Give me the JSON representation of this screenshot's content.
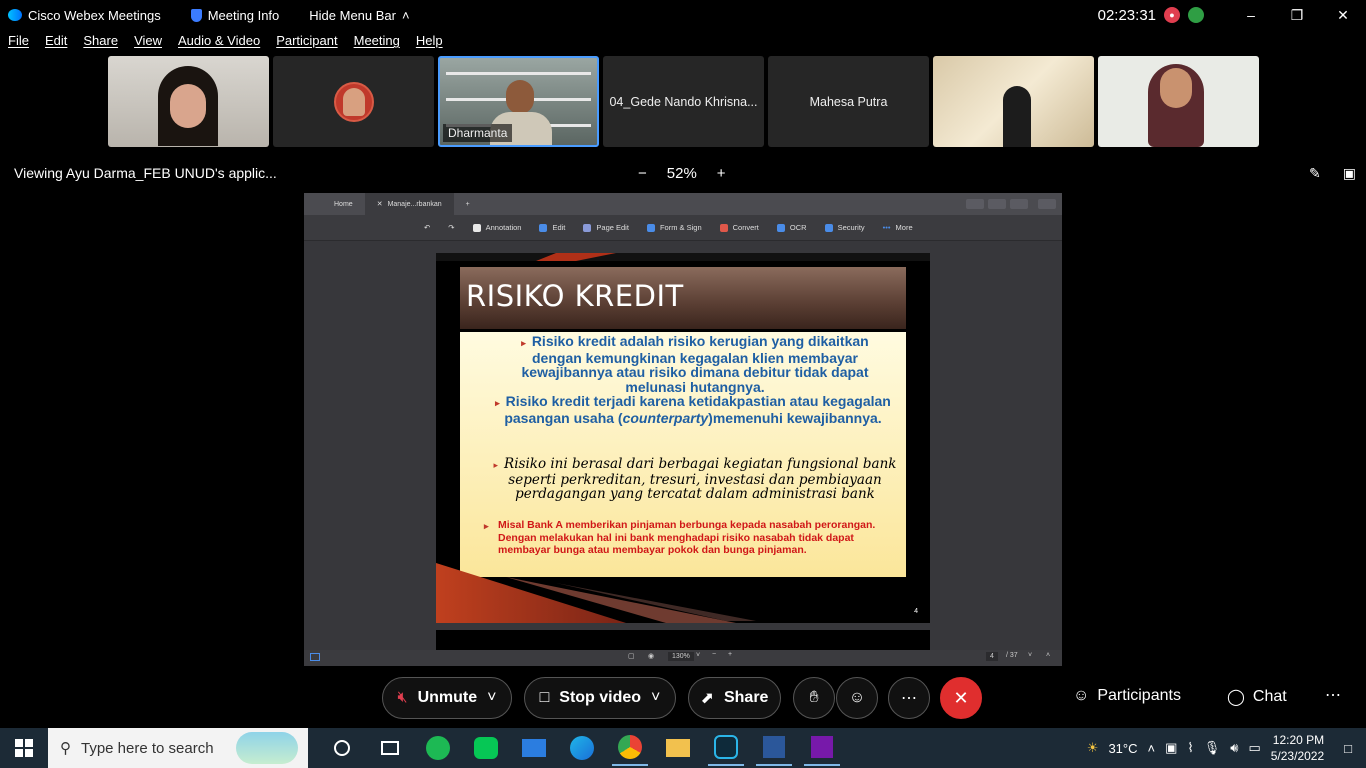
{
  "titlebar": {
    "app_name": "Cisco Webex Meetings",
    "meeting_info": "Meeting Info",
    "hide_menu": "Hide Menu Bar",
    "clock": "02:23:31"
  },
  "menu": [
    "File",
    "Edit",
    "Share",
    "View",
    "Audio & Video",
    "Participant",
    "Meeting",
    "Help"
  ],
  "thumbnails": {
    "active_name": "Dharmanta",
    "name4": "04_Gede Nando Khrisna...",
    "name5": "Mahesa Putra"
  },
  "viewbar": {
    "viewing": "Viewing Ayu Darma_FEB UNUD's applic...",
    "zoom": "52%"
  },
  "pdf": {
    "tabs": [
      "Home",
      "Manaje...rbankan"
    ],
    "tools": [
      "Annotation",
      "Edit",
      "Page Edit",
      "Form & Sign",
      "Convert",
      "OCR",
      "Security",
      "More"
    ],
    "zoom": "130%",
    "page": "4",
    "page_total": "/ 37"
  },
  "slide": {
    "title": "RISIKO KREDIT",
    "b1": "Risiko kredit adalah risiko kerugian yang dikaitkan dengan kemungkinan kegagalan klien membayar kewajibannya atau risiko dimana debitur tidak dapat melunasi hutangnya.",
    "b2a": "Risiko kredit terjadi karena ketidakpastian atau kegagalan pasangan usaha (",
    "b2i": "counterparty",
    "b2b": ")memenuhi kewajibannya.",
    "b3": "Risiko ini berasal dari berbagai kegiatan fungsional bank seperti perkreditan, tresuri, investasi dan pembiayaan perdagangan yang tercatat dalam administrasi bank",
    "b4": "Misal Bank A memberikan pinjaman berbunga kepada nasabah perorangan. Dengan melakukan hal ini  bank menghadapi risiko nasabah tidak dapat membayar bunga atau membayar pokok dan bunga pinjaman.",
    "page_number": "4"
  },
  "controls": {
    "unmute": "Unmute",
    "stop_video": "Stop video",
    "share": "Share",
    "participants": "Participants",
    "chat": "Chat"
  },
  "taskbar": {
    "search_placeholder": "Type here to search",
    "temperature": "31°C",
    "time": "12:20 PM",
    "date": "5/23/2022"
  },
  "colors": {
    "end_button": "#e02e2e",
    "slide_blue": "#1f5fa3",
    "slide_red": "#d01818"
  }
}
